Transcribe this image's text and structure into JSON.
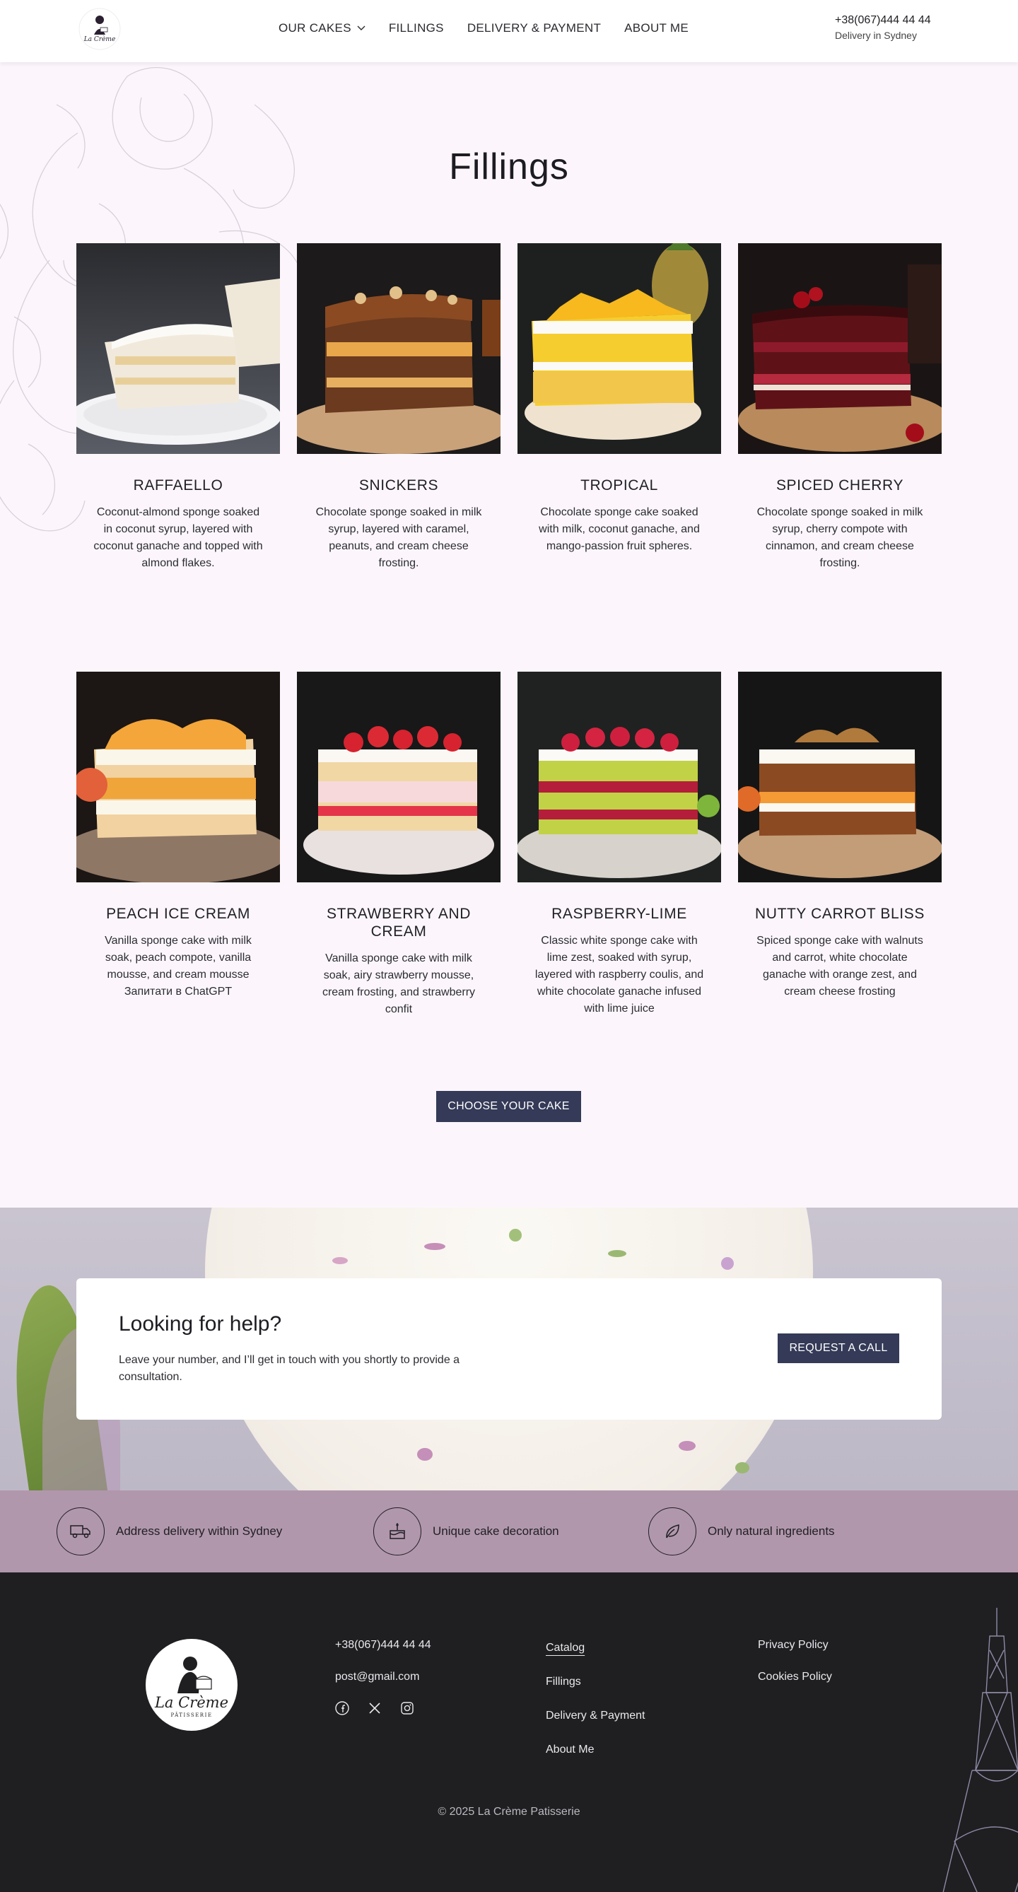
{
  "header": {
    "nav": [
      {
        "label": "OUR CAKES",
        "has_dropdown": true
      },
      {
        "label": "FILLINGS"
      },
      {
        "label": "DELIVERY & PAYMENT"
      },
      {
        "label": "ABOUT ME"
      }
    ],
    "phone": "+38(067)444 44 44",
    "delivery_note": "Delivery in Sydney",
    "logo_text": "La Crème"
  },
  "fillings": {
    "title": "Fillings",
    "items": [
      {
        "name": "RAFFAELLO",
        "description": "Coconut-almond sponge soaked in coconut syrup, layered with coconut ganache and topped with almond flakes."
      },
      {
        "name": "SNICKERS",
        "description": "Chocolate sponge soaked in milk syrup, layered with caramel, peanuts, and cream cheese frosting."
      },
      {
        "name": "TROPICAL",
        "description": "Chocolate sponge cake soaked with milk, coconut ganache, and mango-passion fruit spheres."
      },
      {
        "name": "SPICED CHERRY",
        "description": "Chocolate sponge soaked in milk syrup, cherry compote with cinnamon, and cream cheese frosting."
      },
      {
        "name": "PEACH ICE CREAM",
        "description": "Vanilla sponge cake with milk soak, peach compote, vanilla mousse, and cream mousse Запитати в ChatGPT"
      },
      {
        "name": "STRAWBERRY AND CREAM",
        "description": "Vanilla sponge cake with milk soak, airy strawberry mousse, cream frosting, and strawberry confit"
      },
      {
        "name": "RASPBERRY-LIME",
        "description": "Classic white sponge cake with lime zest, soaked with syrup, layered with raspberry coulis, and white chocolate ganache infused with lime juice"
      },
      {
        "name": "NUTTY CARROT BLISS",
        "description": "Spiced sponge cake with walnuts and carrot, white chocolate ganache with orange zest, and cream cheese frosting"
      }
    ],
    "cta": "CHOOSE YOUR CAKE"
  },
  "help": {
    "title": "Looking for help?",
    "text": "Leave your number, and I’ll get in touch with you shortly to provide a consultation.",
    "button": "REQUEST A CALL"
  },
  "features": [
    {
      "icon": "delivery-truck-icon",
      "label": "Address delivery within Sydney"
    },
    {
      "icon": "cake-icon",
      "label": "Unique cake decoration"
    },
    {
      "icon": "leaf-icon",
      "label": "Only natural ingredients"
    }
  ],
  "footer": {
    "logo_text": "La Crème",
    "logo_subtext": "PÂTISSERIE",
    "phone": "+38(067)444 44 44",
    "email": "post@gmail.com",
    "socials": [
      "facebook-icon",
      "x-icon",
      "instagram-icon"
    ],
    "nav": [
      "Catalog",
      "Fillings",
      "Delivery & Payment",
      "About Me"
    ],
    "legal": [
      "Privacy Policy",
      "Cookies Policy"
    ],
    "copyright": "© 2025 La Crème Patisserie"
  },
  "colors": {
    "accent_button": "#343a57",
    "page_bg": "#fcf6fc",
    "features_bg": "#b197ac",
    "footer_bg": "#1f1f21"
  }
}
